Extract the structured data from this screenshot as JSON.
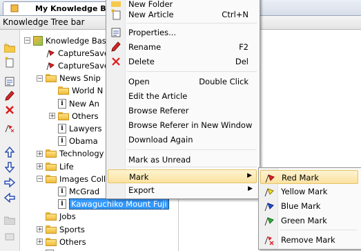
{
  "tab": {
    "title": "My Knowledge Base"
  },
  "tree_bar": {
    "title": "Knowledge Tree bar"
  },
  "toolbar": {
    "buttons": [
      "new-folder-icon",
      "new-article-icon",
      "properties-icon",
      "rename-icon",
      "delete-icon",
      "mark-icon",
      "move-up-icon",
      "move-down-icon",
      "move-right-icon",
      "move-left-icon",
      "disabled-folder-icon",
      "disabled-move-icon"
    ]
  },
  "tree": {
    "root": "Knowledge Base",
    "items": [
      {
        "label": "CaptureSave",
        "type": "marked",
        "level": 1
      },
      {
        "label": "CaptureSave",
        "type": "marked",
        "level": 1
      },
      {
        "label": "News Snip",
        "type": "folder",
        "level": 1,
        "expander": "-"
      },
      {
        "label": "World N",
        "type": "folder",
        "level": 2
      },
      {
        "label": "New An",
        "type": "article",
        "level": 2
      },
      {
        "label": "Others",
        "type": "folder",
        "level": 2,
        "expander": "+"
      },
      {
        "label": "Lawyers",
        "type": "article",
        "level": 2
      },
      {
        "label": "Obama",
        "type": "article",
        "level": 2
      },
      {
        "label": "Technology",
        "type": "folder",
        "level": 1,
        "expander": "+"
      },
      {
        "label": "Life",
        "type": "folder",
        "level": 1,
        "expander": "+"
      },
      {
        "label": "Images Coll",
        "type": "folder",
        "level": 1,
        "expander": "-"
      },
      {
        "label": "McGrad",
        "type": "article",
        "level": 2
      },
      {
        "label": "Kawaguchiko Mount Fuji",
        "type": "article",
        "level": 2,
        "selected": true
      },
      {
        "label": "Jobs",
        "type": "folder",
        "level": 1
      },
      {
        "label": "Sports",
        "type": "folder",
        "level": 1,
        "expander": "+"
      },
      {
        "label": "Others",
        "type": "folder",
        "level": 1,
        "expander": "+"
      },
      {
        "label": "New Article",
        "type": "article",
        "level": 1
      }
    ]
  },
  "context_menu": {
    "items": [
      {
        "label": "New Folder",
        "shortcut": ""
      },
      {
        "label": "New Article",
        "shortcut": "Ctrl+N"
      },
      {
        "label": "Properties...",
        "shortcut": ""
      },
      {
        "label": "Rename",
        "shortcut": "F2"
      },
      {
        "label": "Delete",
        "shortcut": "Del"
      },
      {
        "label": "Open",
        "shortcut": "Double Click"
      },
      {
        "label": "Edit the Article",
        "shortcut": ""
      },
      {
        "label": "Browse Referer",
        "shortcut": ""
      },
      {
        "label": "Browse Referer in New Window",
        "shortcut": ""
      },
      {
        "label": "Download Again",
        "shortcut": ""
      },
      {
        "label": "Mark as Unread",
        "shortcut": ""
      },
      {
        "label": "Mark",
        "shortcut": "",
        "submenu": true,
        "highlighted": true
      },
      {
        "label": "Export",
        "shortcut": "",
        "submenu": true
      }
    ]
  },
  "mark_submenu": {
    "items": [
      {
        "label": "Red Mark",
        "color": "#e0202a",
        "highlighted": true
      },
      {
        "label": "Yellow Mark",
        "color": "#f2e21c"
      },
      {
        "label": "Blue Mark",
        "color": "#1d4fd6"
      },
      {
        "label": "Green Mark",
        "color": "#2fb236"
      },
      {
        "label": "Remove Mark",
        "color": "#e0202a"
      }
    ]
  }
}
